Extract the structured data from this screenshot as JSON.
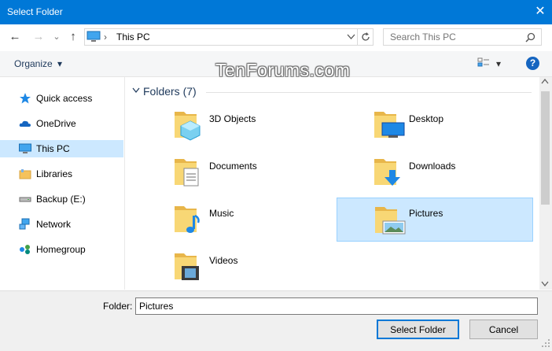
{
  "window": {
    "title": "Select Folder",
    "close_glyph": "✕"
  },
  "nav": {
    "back": "←",
    "forward": "→",
    "recent": "⌄",
    "up": "↑"
  },
  "address": {
    "separator": "›",
    "path": "This PC"
  },
  "search": {
    "placeholder": "Search This PC"
  },
  "toolbar": {
    "organize_label": "Organize",
    "organize_caret": "▾",
    "view_caret": "▾",
    "help_glyph": "?"
  },
  "watermark": "TenForums.com",
  "sidebar": {
    "items": [
      {
        "label": "Quick access",
        "icon": "quick-access-star-icon"
      },
      {
        "label": "OneDrive",
        "icon": "onedrive-cloud-icon"
      },
      {
        "label": "This PC",
        "icon": "this-pc-monitor-icon",
        "selected": true
      },
      {
        "label": "Libraries",
        "icon": "libraries-icon"
      },
      {
        "label": "Backup (E:)",
        "icon": "drive-icon"
      },
      {
        "label": "Network",
        "icon": "network-icon"
      },
      {
        "label": "Homegroup",
        "icon": "homegroup-icon"
      }
    ]
  },
  "content": {
    "group_title": "Folders (7)",
    "folders": [
      {
        "label": "3D Objects",
        "icon": "3d-objects-folder-icon"
      },
      {
        "label": "Desktop",
        "icon": "desktop-folder-icon"
      },
      {
        "label": "Documents",
        "icon": "documents-folder-icon"
      },
      {
        "label": "Downloads",
        "icon": "downloads-folder-icon"
      },
      {
        "label": "Music",
        "icon": "music-folder-icon"
      },
      {
        "label": "Pictures",
        "icon": "pictures-folder-icon",
        "selected": true
      },
      {
        "label": "Videos",
        "icon": "videos-folder-icon"
      }
    ]
  },
  "bottom": {
    "folder_label": "Folder:",
    "folder_value": "Pictures",
    "select_button": "Select Folder",
    "cancel_button": "Cancel"
  },
  "colors": {
    "titlebar": "#0078d7",
    "selection": "#cce8ff",
    "accent": "#0078d7"
  }
}
